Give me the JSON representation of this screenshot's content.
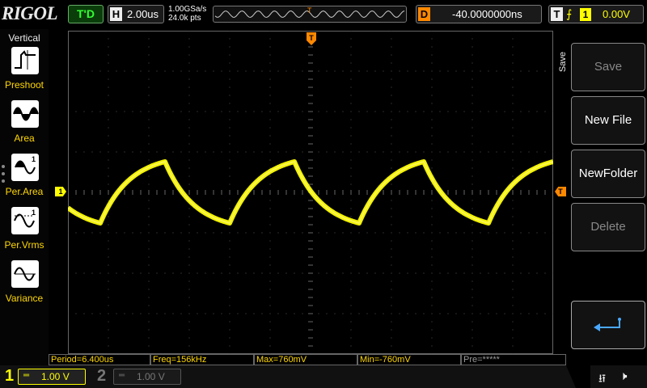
{
  "brand": "RIGOL",
  "status": "T'D",
  "timebase": {
    "tag": "H",
    "value": "2.00us"
  },
  "sampling": {
    "rate": "1.00GSa/s",
    "points": "24.0k pts"
  },
  "memory_trigger_mark": "T",
  "delay": {
    "tag": "D",
    "value": "-40.0000000ns"
  },
  "trigger": {
    "tag": "T",
    "edge_symbol": "⨍",
    "source": "1",
    "level": "0.00V"
  },
  "left_menu": {
    "title": "Vertical",
    "items": [
      {
        "label": "Preshoot",
        "icon": "preshoot-icon"
      },
      {
        "label": "Area",
        "icon": "area-icon"
      },
      {
        "label": "Per.Area",
        "icon": "per-area-icon"
      },
      {
        "label": "Per.Vrms",
        "icon": "per-vrms-icon"
      },
      {
        "label": "Variance",
        "icon": "variance-icon"
      }
    ]
  },
  "markers": {
    "ch1": "1",
    "trigger_top": "T",
    "trigger_level": "T"
  },
  "right_menu": {
    "title": "Save",
    "buttons": [
      {
        "label": "Save",
        "enabled": false
      },
      {
        "label": "New File",
        "enabled": true
      },
      {
        "label": "NewFolder",
        "enabled": true
      },
      {
        "label": "Delete",
        "enabled": false
      }
    ],
    "return_icon": "return-arrow-icon"
  },
  "measurements": [
    {
      "label": "Period=6.400us"
    },
    {
      "label": "Freq=156kHz"
    },
    {
      "label": "Max=760mV"
    },
    {
      "label": "Min=-760mV"
    },
    {
      "label": "Pre=*****"
    }
  ],
  "channels": [
    {
      "number": "1",
      "coupling": "═",
      "scale": "1.00 V",
      "active": true
    },
    {
      "number": "2",
      "coupling": "═",
      "scale": "1.00 V",
      "active": false
    }
  ],
  "colors": {
    "ch1": "#ffff00",
    "trigger": "#ff8800",
    "status": "#33ff33",
    "grid": "#555555"
  },
  "icons": {
    "usb": "usb-icon",
    "mute": "speaker-mute-icon"
  }
}
